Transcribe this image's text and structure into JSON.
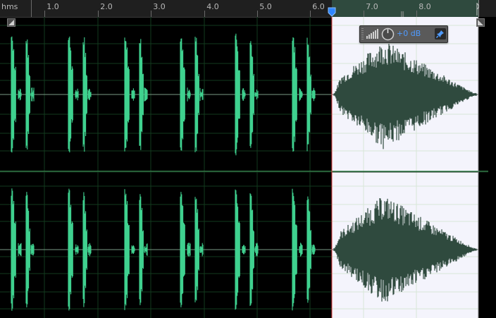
{
  "ruler": {
    "units_label": "hms",
    "ticks": [
      "1.0",
      "2.0",
      "3.0",
      "4.0",
      "5.0",
      "6.0",
      "7.0",
      "8.0"
    ]
  },
  "hud": {
    "volume_label": "+0 dB"
  },
  "colors": {
    "background": "#000000",
    "waveform": "#3fd18f",
    "selection_background": "#f4f4fc",
    "selection_waveform": "#2f4a3e",
    "playhead": "#2f86ff",
    "selection_edge": "#e04040"
  },
  "selection": {
    "start_seconds": 6.2,
    "end_seconds": 8.95
  },
  "icons": [
    "volume-meter-icon",
    "volume-knob-icon",
    "pin-icon",
    "zoom-handle-icon",
    "playhead-marker-icon"
  ]
}
